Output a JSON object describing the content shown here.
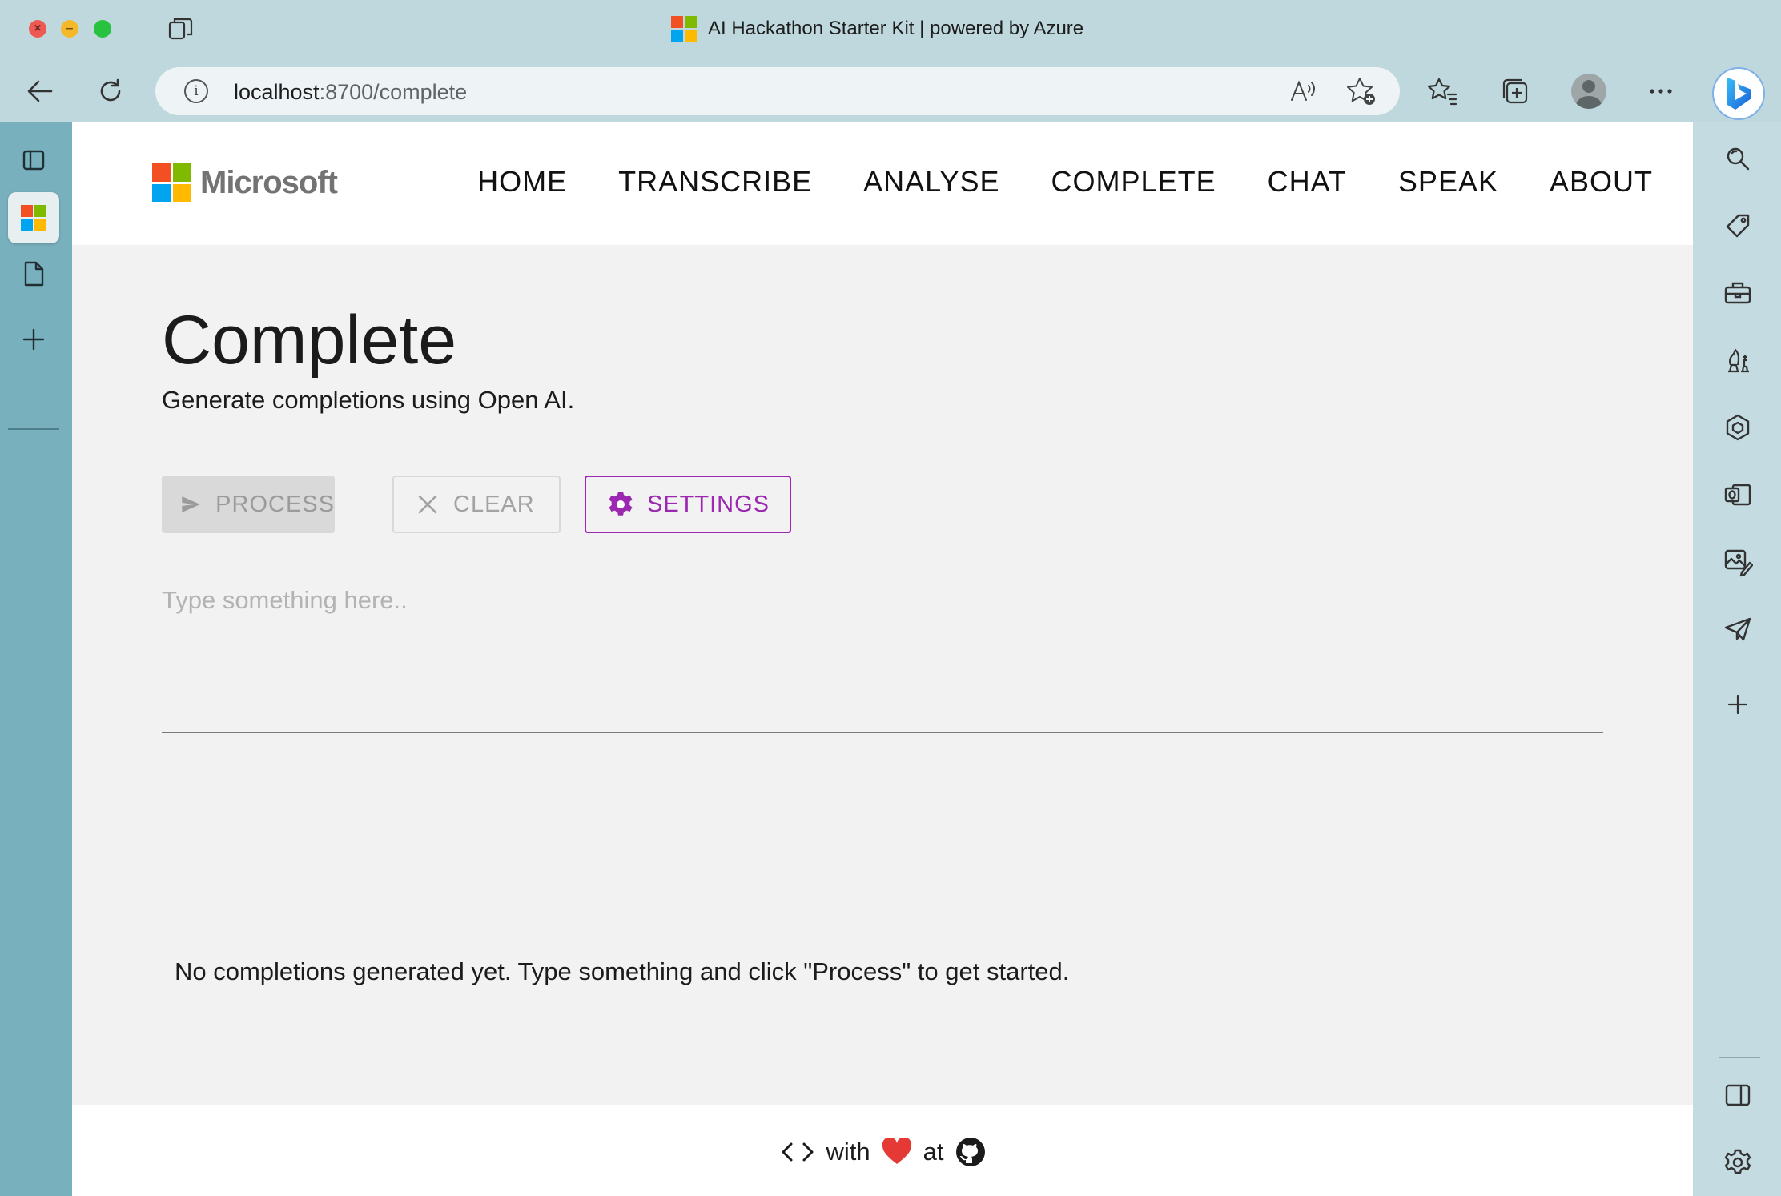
{
  "window": {
    "title": "AI Hackathon Starter Kit | powered by Azure"
  },
  "addressbar": {
    "host": "localhost",
    "path": ":8700/complete"
  },
  "brand": {
    "name": "Microsoft",
    "logo_colors": [
      "#f25022",
      "#7fba00",
      "#00a4ef",
      "#ffb900"
    ]
  },
  "nav": {
    "items": [
      {
        "label": "HOME"
      },
      {
        "label": "TRANSCRIBE"
      },
      {
        "label": "ANALYSE"
      },
      {
        "label": "COMPLETE"
      },
      {
        "label": "CHAT"
      },
      {
        "label": "SPEAK"
      },
      {
        "label": "ABOUT"
      }
    ]
  },
  "page": {
    "title": "Complete",
    "subtitle": "Generate completions using Open AI."
  },
  "actions": {
    "process_label": "PROCESS",
    "clear_label": "CLEAR",
    "settings_label": "SETTINGS",
    "accent_color": "#9c27b0"
  },
  "prompt": {
    "placeholder": "Type something here..",
    "value": ""
  },
  "results": {
    "empty_message": "No completions generated yet. Type something and click \"Process\" to get started."
  },
  "footer": {
    "with_text": "with",
    "at_text": "at"
  }
}
